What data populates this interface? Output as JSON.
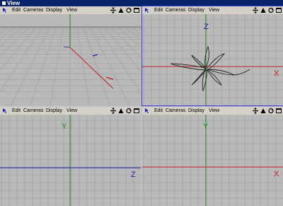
{
  "window": {
    "title": "View"
  },
  "menu": {
    "edit": "Edit",
    "cameras": "Cameras",
    "display": "Display",
    "view": "View"
  },
  "icons": [
    "pan-icon",
    "dolly-icon",
    "rotate-icon",
    "maximize-icon"
  ],
  "viewports": [
    {
      "id": "perspective",
      "axes": []
    },
    {
      "id": "top-right",
      "axes": [
        "Z",
        "X"
      ]
    },
    {
      "id": "bottom-left",
      "axes": [
        "Y",
        "Z"
      ]
    },
    {
      "id": "bottom-right",
      "axes": [
        "Y",
        "X"
      ]
    }
  ],
  "colors": {
    "grid_bg": "#b9b9b9",
    "grid_line": "#9a9a9a",
    "axis_x": "#c81e1e",
    "axis_y": "#148c14",
    "axis_z": "#1e1eb4",
    "active_border": "#3b3bd6"
  }
}
